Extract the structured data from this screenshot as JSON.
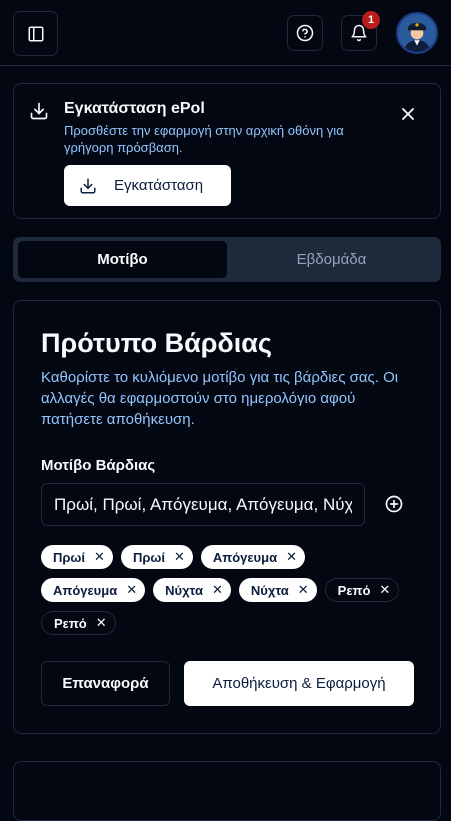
{
  "header": {
    "notification_count": "1"
  },
  "install_banner": {
    "title": "Εγκατάσταση ePol",
    "description": "Προσθέστε την εφαρμογή στην αρχική οθόνη για γρήγορη πρόσβαση.",
    "button_label": "Εγκατάσταση"
  },
  "tabs": [
    {
      "label": "Μοτίβο",
      "active": true
    },
    {
      "label": "Εβδομάδα",
      "active": false
    }
  ],
  "shift_template": {
    "title": "Πρότυπο Βάρδιας",
    "description": "Καθορίστε το κυλιόμενο μοτίβο για τις βάρδιες σας. Οι αλλαγές θα εφαρμοστούν στο ημερολόγιο αφού πατήσετε αποθήκευση.",
    "pattern_label": "Μοτίβο Βάρδιας",
    "pattern_value": "Πρωί, Πρωί, Απόγευμα, Απόγευμα, Νύχτα, Νύχτα, Ρεπό, Ρεπό",
    "chips": [
      "Πρωί",
      "Πρωί",
      "Απόγευμα",
      "Απόγευμα",
      "Νύχτα",
      "Νύχτα",
      "Ρεπό",
      "Ρεπό"
    ],
    "reset_label": "Επαναφορά",
    "save_label": "Αποθήκευση & Εφαρμογή"
  },
  "colors": {
    "background": "#030712",
    "border": "#1e293b",
    "muted_text": "#93c5fd",
    "badge": "#b91c1c"
  }
}
